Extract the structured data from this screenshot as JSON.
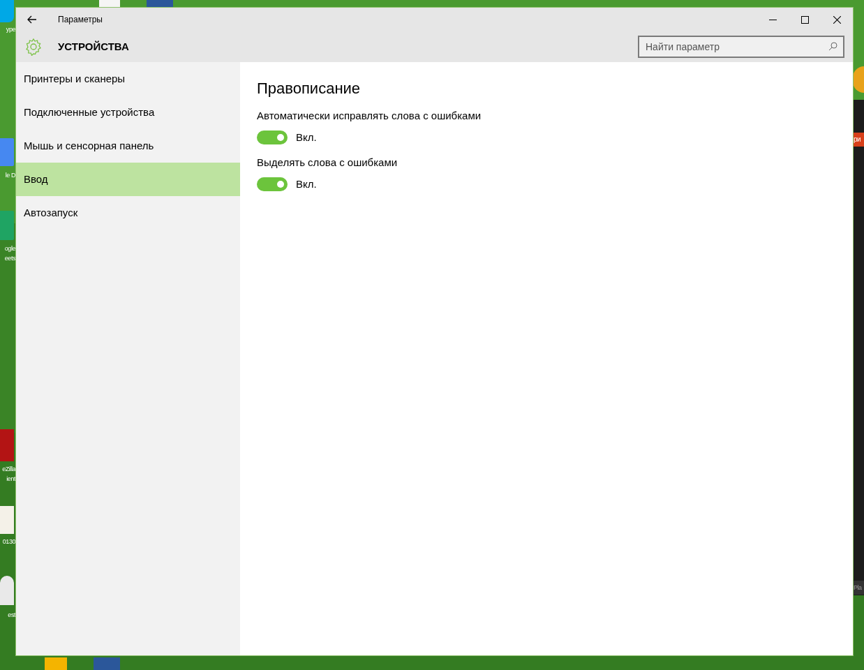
{
  "window": {
    "title": "Параметры",
    "section": "УСТРОЙСТВА",
    "search": {
      "placeholder": "Найти параметр"
    }
  },
  "sidebar": {
    "items": [
      {
        "label": "Принтеры и сканеры",
        "selected": false
      },
      {
        "label": "Подключенные устройства",
        "selected": false
      },
      {
        "label": "Мышь и сенсорная панель",
        "selected": false
      },
      {
        "label": "Ввод",
        "selected": true
      },
      {
        "label": "Автозапуск",
        "selected": false
      }
    ]
  },
  "content": {
    "heading": "Правописание",
    "settings": [
      {
        "label": "Автоматически исправлять слова с ошибками",
        "on": true,
        "state_text": "Вкл."
      },
      {
        "label": "Выделять слова с ошибками",
        "on": true,
        "state_text": "Вкл."
      }
    ]
  },
  "desktop": {
    "left_labels": [
      {
        "lines": [
          "ype"
        ]
      },
      {
        "lines": [
          "le D"
        ]
      },
      {
        "lines": [
          "ogle",
          "eets"
        ]
      },
      {
        "lines": [
          "eZilla",
          "ient"
        ]
      },
      {
        "lines": [
          "0130"
        ]
      },
      {
        "lines": [
          "est"
        ]
      }
    ],
    "right_labels": [
      "ри",
      "Pla"
    ]
  }
}
